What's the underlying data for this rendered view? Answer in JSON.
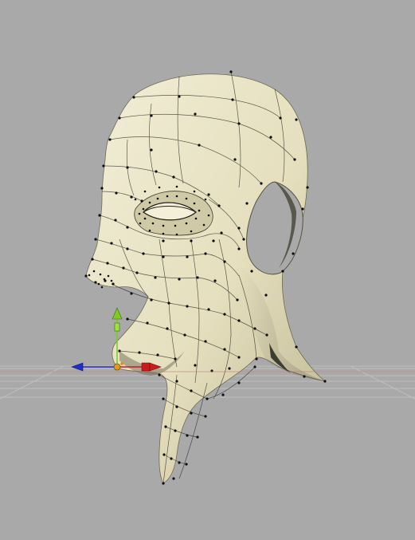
{
  "viewport": {
    "background": "#a9a9a9",
    "mesh_color": "#e8e3c3",
    "wire_color": "#2b2a22",
    "vertex_color": "#0d0d0d",
    "ground_grid_color": "#c4c4c4"
  },
  "gizmo": {
    "type": "move-translate",
    "axes": [
      {
        "name": "y-axis",
        "color": "#7ecb26"
      },
      {
        "name": "x-axis",
        "color": "#c81d1d"
      },
      {
        "name": "z-axis",
        "color": "#1f2fc8"
      }
    ],
    "pivot_color": "#e09a1f",
    "selection_highlight": "#ff7a00"
  },
  "icons": {
    "move": "move-gizmo-icon",
    "pivot": "pivot-icon"
  }
}
